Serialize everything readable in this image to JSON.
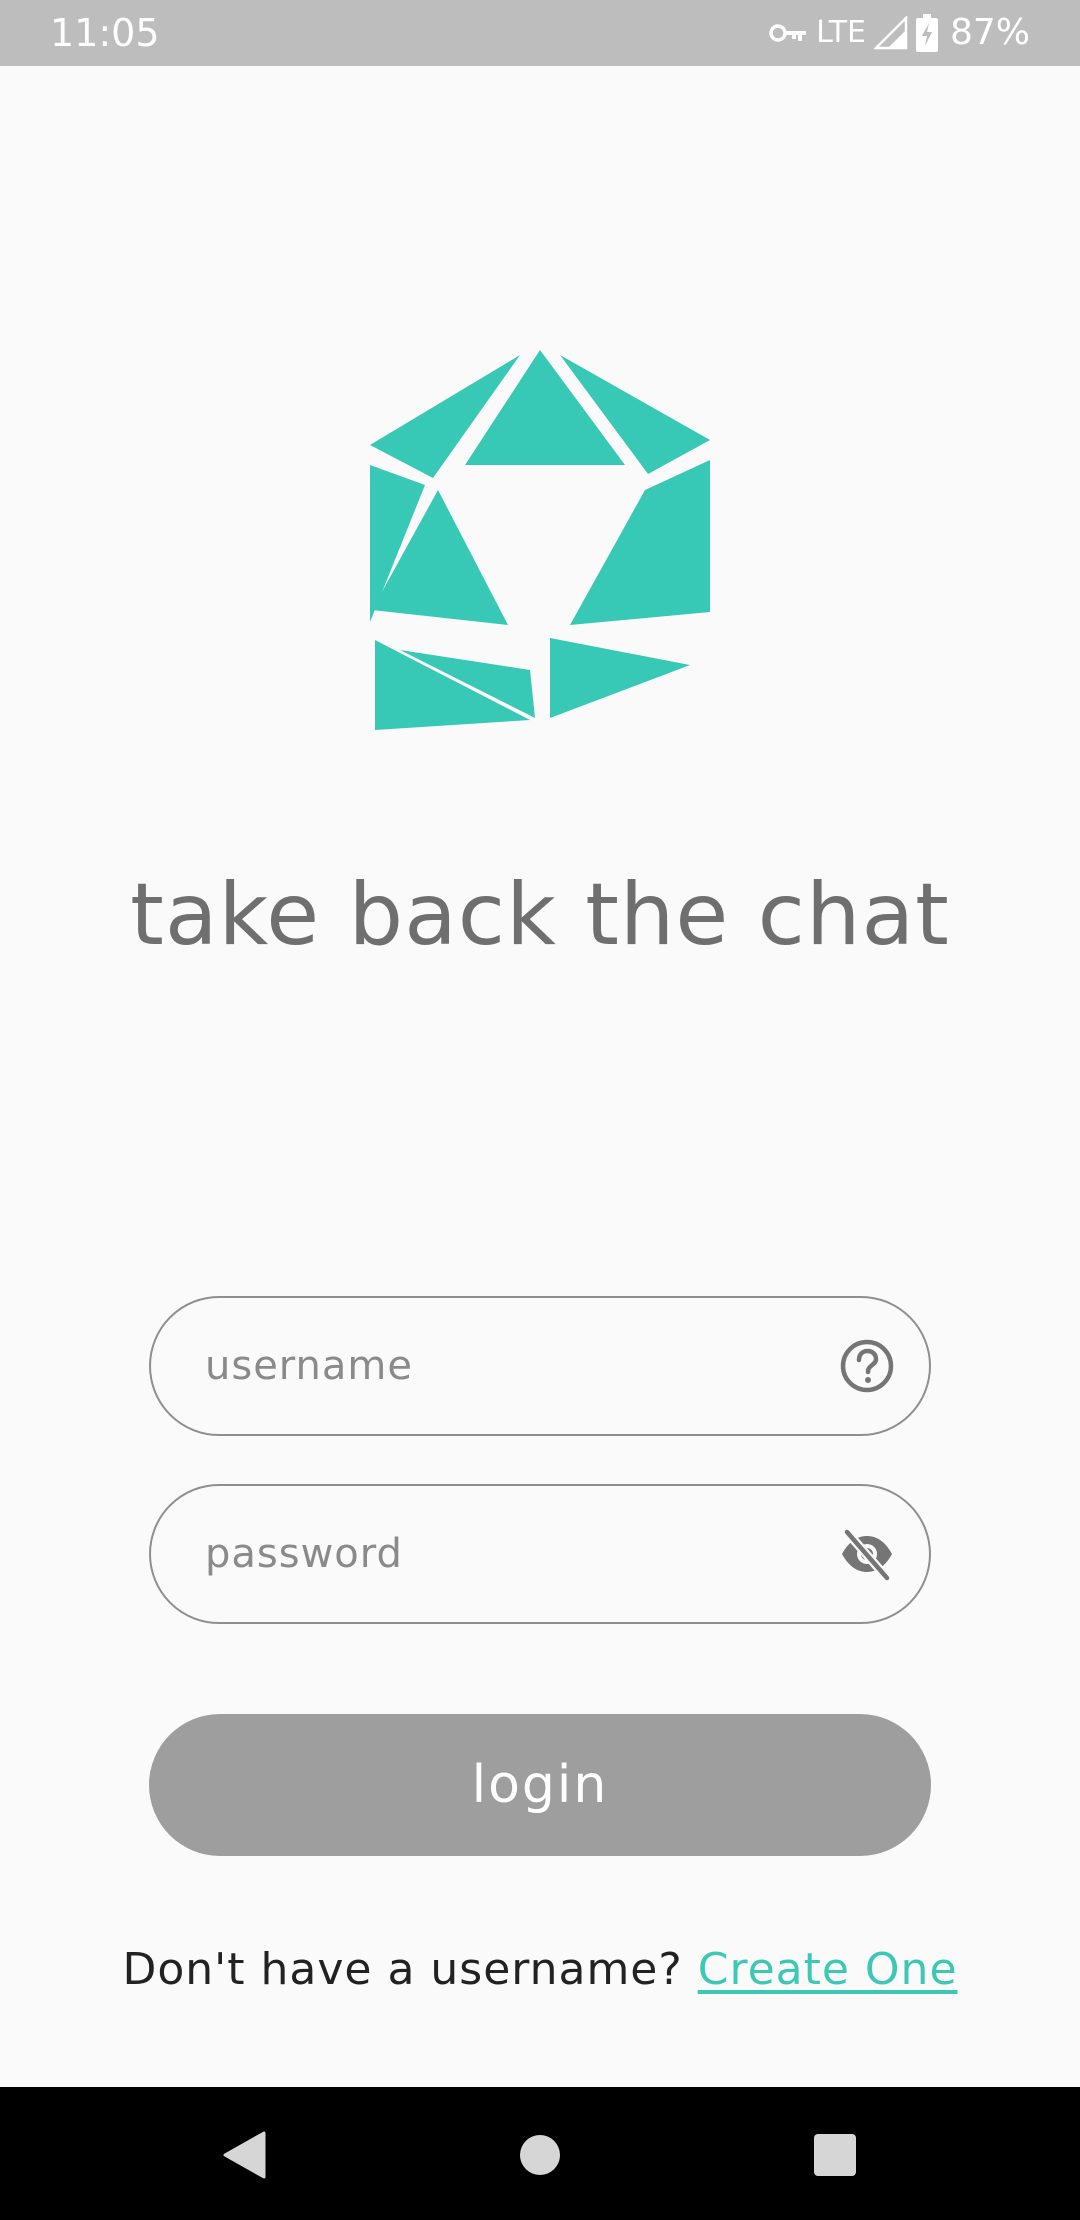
{
  "status_bar": {
    "time": "11:05",
    "network": "LTE",
    "battery": "87%"
  },
  "brand": {
    "accent_color": "#38c8b6",
    "logo_icon": "crystal-logo-icon",
    "tagline": "take back the chat"
  },
  "form": {
    "username_placeholder": "username",
    "username_value": "",
    "username_help_icon": "question-circle-icon",
    "password_placeholder": "password",
    "password_value": "",
    "password_toggle_icon": "eye-off-icon",
    "login_label": "login",
    "login_color": "#9e9e9e"
  },
  "signup": {
    "prompt": "Don't have a username?",
    "link_label": "Create One",
    "link_color": "#3cc8b4"
  },
  "nav_bar": {
    "back_icon": "back-triangle-icon",
    "home_icon": "home-circle-icon",
    "recents_icon": "recents-square-icon"
  }
}
